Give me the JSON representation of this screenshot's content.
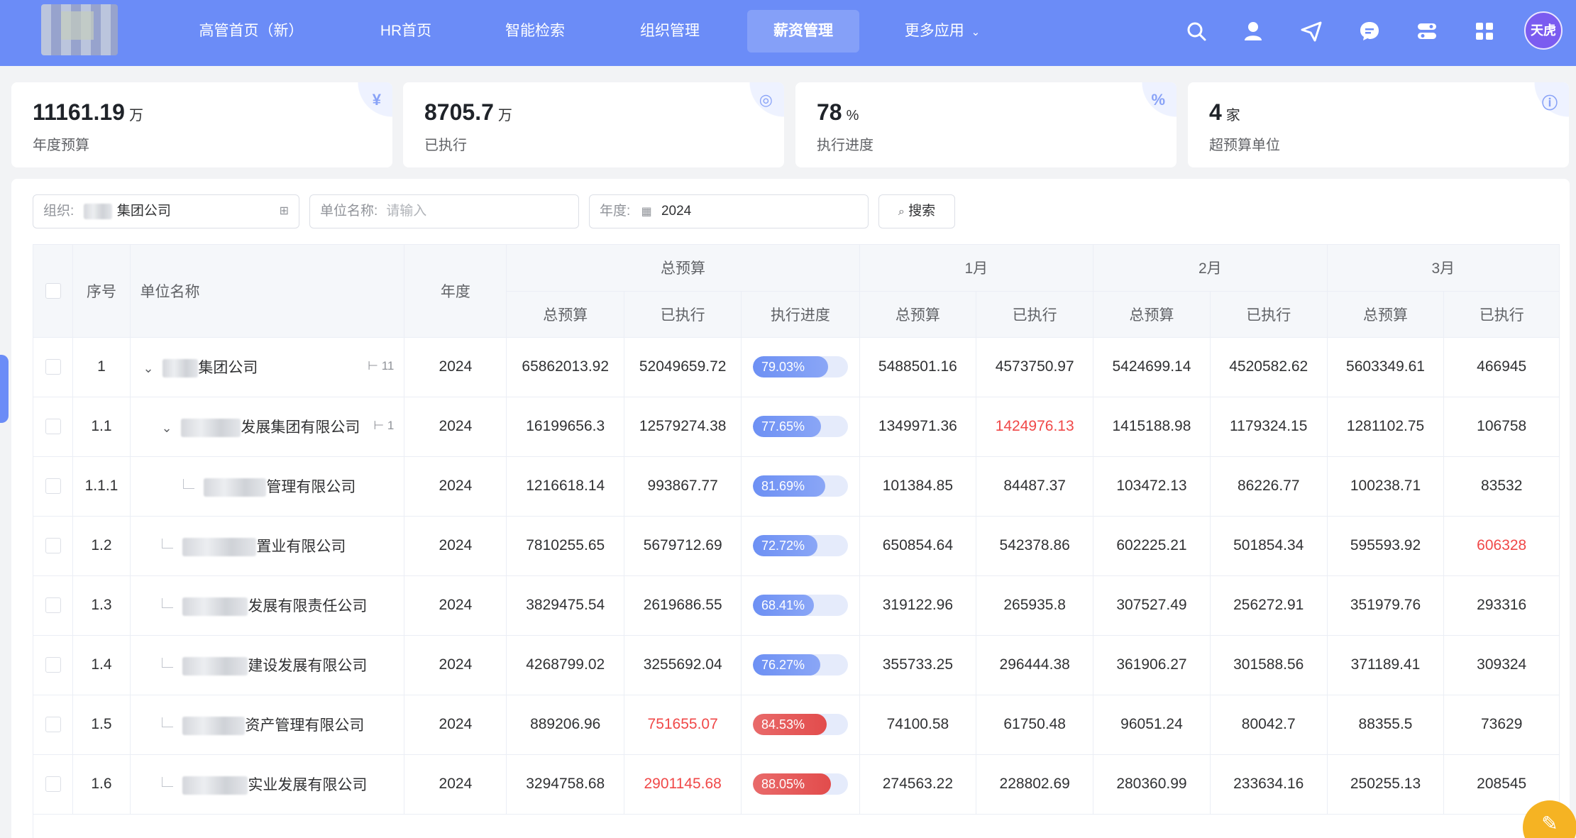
{
  "nav": {
    "items": [
      "高管首页（新）",
      "HR首页",
      "智能检索",
      "组织管理",
      "薪资管理",
      "更多应用"
    ],
    "active": "薪资管理",
    "avatar": "天虎"
  },
  "stats": [
    {
      "value": "11161.19",
      "unit": "万",
      "label": "年度预算",
      "icon": "yuan-icon",
      "glyph": "¥"
    },
    {
      "value": "8705.7",
      "unit": "万",
      "label": "已执行",
      "icon": "target-icon",
      "glyph": "◎"
    },
    {
      "value": "78",
      "unit": "%",
      "label": "执行进度",
      "icon": "percent-icon",
      "glyph": "%"
    },
    {
      "value": "4",
      "unit": "家",
      "label": "超预算单位",
      "icon": "info-icon",
      "glyph": "ⓘ"
    }
  ],
  "filters": {
    "org_label": "组织:",
    "org_value": "集团公司",
    "unit_label": "单位名称:",
    "unit_placeholder": "请输入",
    "year_label": "年度:",
    "year_value": "2024",
    "search_label": "搜索"
  },
  "table": {
    "headers": {
      "seq": "序号",
      "name": "单位名称",
      "year": "年度",
      "group_total": "总预算",
      "group_m1": "1月",
      "group_m2": "2月",
      "group_m3": "3月",
      "total_budget": "总预算",
      "executed": "已执行",
      "progress": "执行进度"
    },
    "rows": [
      {
        "seq": "1",
        "name": "集团公司",
        "children": "11",
        "year": "2024",
        "budget": "65862013.92",
        "exec": "52049659.72",
        "progress": "79.03%",
        "pct": 79.03,
        "m1b": "5488501.16",
        "m1e": "4573750.97",
        "m2b": "5424699.14",
        "m2e": "4520582.62",
        "m3b": "5603349.61",
        "m3e": "466945"
      },
      {
        "seq": "1.1",
        "name": "发展集团有限公司",
        "children": "1",
        "year": "2024",
        "budget": "16199656.3",
        "exec": "12579274.38",
        "progress": "77.65%",
        "pct": 77.65,
        "m1b": "1349971.36",
        "m1e": "1424976.13",
        "m2b": "1415188.98",
        "m2e": "1179324.15",
        "m3b": "1281102.75",
        "m3e": "106758"
      },
      {
        "seq": "1.1.1",
        "name": "管理有限公司",
        "year": "2024",
        "budget": "1216618.14",
        "exec": "993867.77",
        "progress": "81.69%",
        "pct": 81.69,
        "m1b": "101384.85",
        "m1e": "84487.37",
        "m2b": "103472.13",
        "m2e": "86226.77",
        "m3b": "100238.71",
        "m3e": "83532"
      },
      {
        "seq": "1.2",
        "name": "置业有限公司",
        "year": "2024",
        "budget": "7810255.65",
        "exec": "5679712.69",
        "progress": "72.72%",
        "pct": 72.72,
        "m1b": "650854.64",
        "m1e": "542378.86",
        "m2b": "602225.21",
        "m2e": "501854.34",
        "m3b": "595593.92",
        "m3e": "606328"
      },
      {
        "seq": "1.3",
        "name": "发展有限责任公司",
        "year": "2024",
        "budget": "3829475.54",
        "exec": "2619686.55",
        "progress": "68.41%",
        "pct": 68.41,
        "m1b": "319122.96",
        "m1e": "265935.8",
        "m2b": "307527.49",
        "m2e": "256272.91",
        "m3b": "351979.76",
        "m3e": "293316"
      },
      {
        "seq": "1.4",
        "name": "建设发展有限公司",
        "year": "2024",
        "budget": "4268799.02",
        "exec": "3255692.04",
        "progress": "76.27%",
        "pct": 76.27,
        "m1b": "355733.25",
        "m1e": "296444.38",
        "m2b": "361906.27",
        "m2e": "301588.56",
        "m3b": "371189.41",
        "m3e": "309324"
      },
      {
        "seq": "1.5",
        "name": "资产管理有限公司",
        "year": "2024",
        "budget": "889206.96",
        "exec": "751655.07",
        "progress": "84.53%",
        "pct": 84.53,
        "m1b": "74100.58",
        "m1e": "61750.48",
        "m2b": "96051.24",
        "m2e": "80042.7",
        "m3b": "88355.5",
        "m3e": "73629"
      },
      {
        "seq": "1.6",
        "name": "实业发展有限公司",
        "year": "2024",
        "budget": "3294758.68",
        "exec": "2901145.68",
        "progress": "88.05%",
        "pct": 88.05,
        "m1b": "274563.22",
        "m1e": "228802.69",
        "m2b": "280360.99",
        "m2e": "233634.16",
        "m3b": "250255.13",
        "m3e": "208545"
      }
    ]
  },
  "colors": {
    "nav": "#6b8cf7",
    "over_budget_text": "#f04848",
    "progress_normal": "#6d90f4",
    "progress_hot": "#e24c4c"
  }
}
